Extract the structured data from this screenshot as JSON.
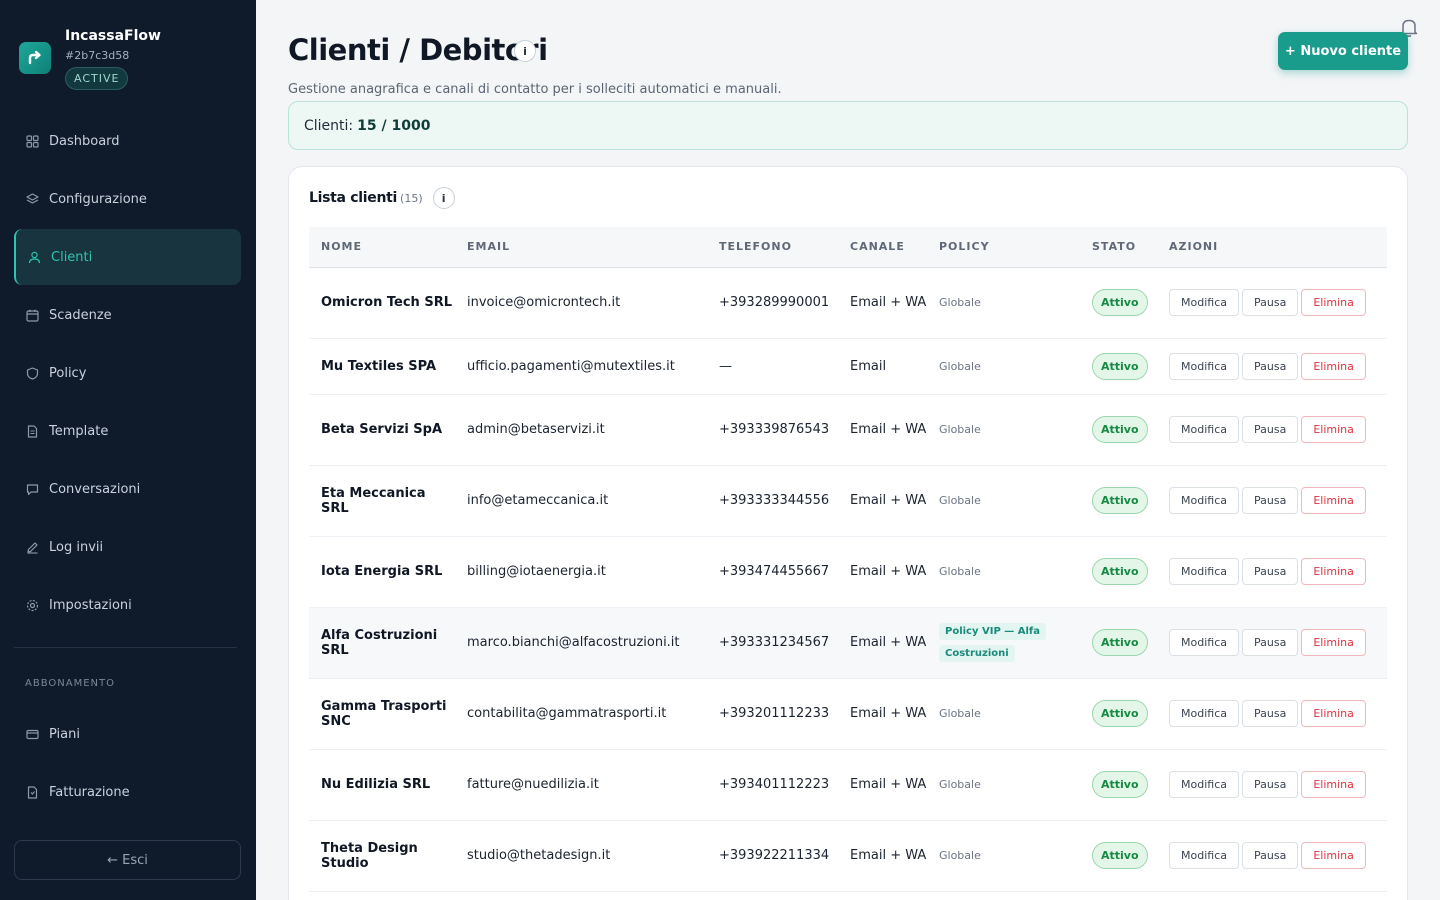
{
  "app": {
    "name": "IncassaFlow",
    "id": "#2b7c3d58",
    "status": "ACTIVE"
  },
  "nav": {
    "items": [
      {
        "label": "Dashboard",
        "icon": "grid-icon"
      },
      {
        "label": "Configurazione",
        "icon": "layers-icon"
      },
      {
        "label": "Clienti",
        "icon": "user-icon",
        "active": true
      },
      {
        "label": "Scadenze",
        "icon": "calendar-icon"
      },
      {
        "label": "Policy",
        "icon": "shield-icon"
      },
      {
        "label": "Template",
        "icon": "document-icon"
      },
      {
        "label": "Conversazioni",
        "icon": "chat-icon"
      },
      {
        "label": "Log invii",
        "icon": "pencil-icon"
      },
      {
        "label": "Impostazioni",
        "icon": "gear-icon"
      }
    ],
    "section_label": "ABBONAMENTO",
    "sub_items": [
      {
        "label": "Piani",
        "icon": "card-icon"
      },
      {
        "label": "Fatturazione",
        "icon": "invoice-icon"
      }
    ],
    "logout_label": "← Esci"
  },
  "header": {
    "title": "Clienti / Debitori",
    "info": "i",
    "new_button": "+ Nuovo cliente",
    "subtitle": "Gestione anagrafica e canali di contatto per i solleciti automatici e manuali."
  },
  "counter": {
    "label": "Clienti:",
    "value": "15 / 1000"
  },
  "list": {
    "title": "Lista clienti",
    "count": "(15)",
    "info": "i",
    "columns": [
      "NOME",
      "EMAIL",
      "TELEFONO",
      "CANALE",
      "POLICY",
      "STATO",
      "AZIONI"
    ],
    "actions": {
      "edit": "Modifica",
      "pause": "Pausa",
      "delete": "Elimina"
    },
    "rows": [
      {
        "name": "Omicron Tech SRL",
        "email": "invoice@omicrontech.it",
        "phone": "+393289990001",
        "channel": "Email + WA",
        "policy": "Globale",
        "status": "Attivo"
      },
      {
        "name": "Mu Textiles SPA",
        "email": "ufficio.pagamenti@mutextiles.it",
        "phone": "—",
        "channel": "Email",
        "policy": "Globale",
        "status": "Attivo"
      },
      {
        "name": "Beta Servizi SpA",
        "email": "admin@betaservizi.it",
        "phone": "+393339876543",
        "channel": "Email + WA",
        "policy": "Globale",
        "status": "Attivo"
      },
      {
        "name": "Eta Meccanica SRL",
        "email": "info@etameccanica.it",
        "phone": "+393333344556",
        "channel": "Email + WA",
        "policy": "Globale",
        "status": "Attivo"
      },
      {
        "name": "Iota Energia SRL",
        "email": "billing@iotaenergia.it",
        "phone": "+393474455667",
        "channel": "Email + WA",
        "policy": "Globale",
        "status": "Attivo"
      },
      {
        "name": "Alfa Costruzioni SRL",
        "email": "marco.bianchi@alfacostruzioni.it",
        "phone": "+393331234567",
        "channel": "Email + WA",
        "policy": "Policy VIP — Alfa Costruzioni",
        "policy_vip": true,
        "status": "Attivo"
      },
      {
        "name": "Gamma Trasporti SNC",
        "email": "contabilita@gammatrasporti.it",
        "phone": "+393201112233",
        "channel": "Email + WA",
        "policy": "Globale",
        "status": "Attivo"
      },
      {
        "name": "Nu Edilizia SRL",
        "email": "fatture@nuedilizia.it",
        "phone": "+393401112223",
        "channel": "Email + WA",
        "policy": "Globale",
        "status": "Attivo"
      },
      {
        "name": "Theta Design Studio",
        "email": "studio@thetadesign.it",
        "phone": "+393922211334",
        "channel": "Email + WA",
        "policy": "Globale",
        "status": "Attivo"
      }
    ]
  },
  "colors": {
    "sidebar_bg": "#0f1a2a",
    "accent": "#1a9c8c",
    "active_text": "#2ec4b0",
    "danger": "#e0323f",
    "status_green": "#168a43"
  }
}
